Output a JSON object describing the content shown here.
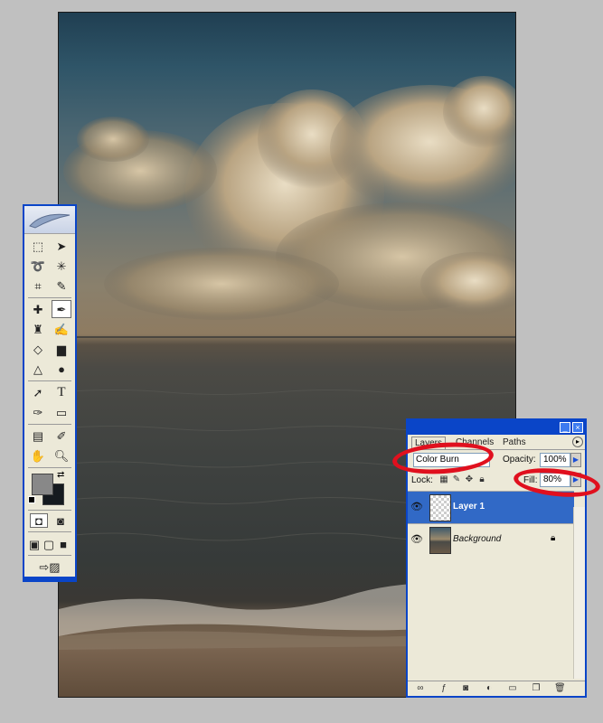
{
  "canvas": {
    "description_icon": "photo-sea-clouds"
  },
  "tools": {
    "icons": [
      "marquee-icon",
      "move-icon",
      "lasso-icon",
      "magic-wand-icon",
      "crop-icon",
      "slice-icon",
      "healing-icon",
      "brush-icon",
      "stamp-icon",
      "history-brush-icon",
      "eraser-icon",
      "gradient-icon",
      "blur-icon",
      "dodge-icon",
      "path-select-icon",
      "type-icon",
      "pen-icon",
      "shape-icon",
      "notes-icon",
      "eyedropper-icon",
      "hand-icon",
      "zoom-icon"
    ]
  },
  "layers_panel": {
    "tabs": [
      "Layers",
      "Channels",
      "Paths"
    ],
    "blend_mode": "Color Burn",
    "opacity_label": "Opacity:",
    "opacity_value": "100%",
    "lock_label": "Lock:",
    "fill_label": "Fill:",
    "fill_value": "80%",
    "layers": [
      {
        "name": "Layer 1",
        "selected": true
      },
      {
        "name": "Background",
        "selected": false,
        "locked": true
      }
    ]
  },
  "colors": {
    "highlight": "#e0101e",
    "selection": "#3169c6",
    "title_bar": "#0a45c8"
  }
}
